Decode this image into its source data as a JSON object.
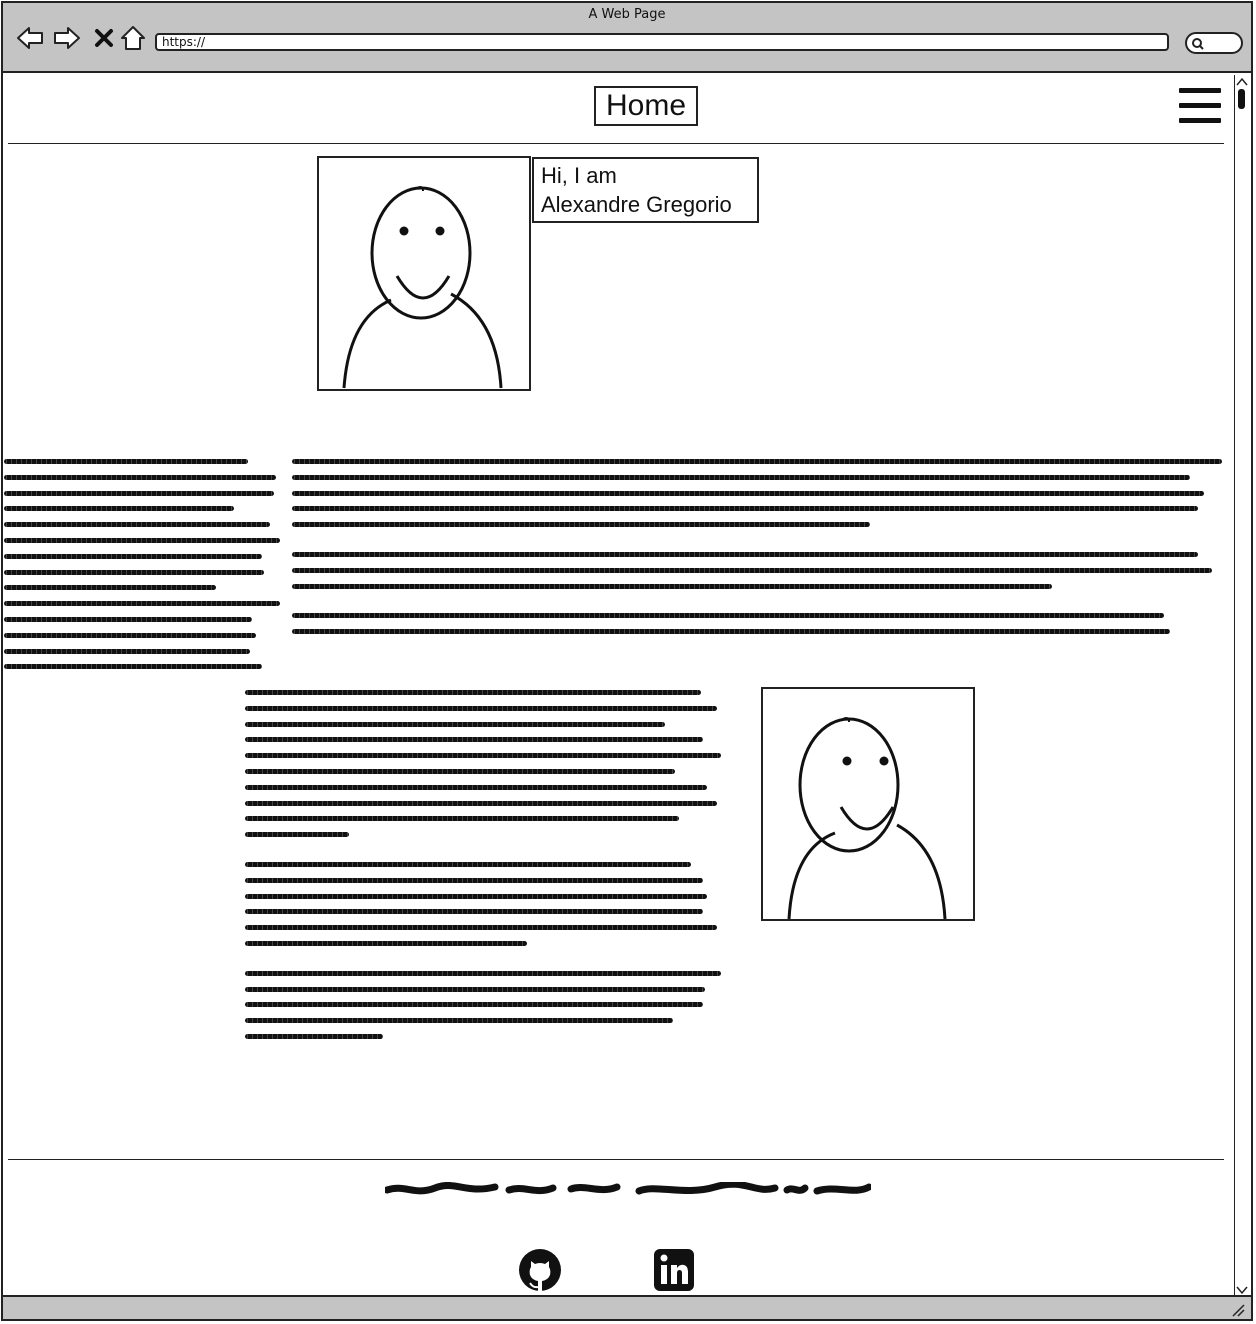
{
  "browser": {
    "window_title": "A Web Page",
    "url": "https://",
    "icons": [
      "back-arrow-icon",
      "forward-arrow-icon",
      "close-icon",
      "home-icon",
      "search-icon"
    ]
  },
  "header": {
    "title": "Home",
    "menu_icon": "hamburger-menu-icon"
  },
  "hero": {
    "greeting_line1": "Hi, I am",
    "greeting_line2": "Alexandre Gregorio",
    "avatar": "user-avatar-placeholder"
  },
  "footer": {
    "social_icons": [
      "github-icon",
      "linkedin-icon"
    ]
  }
}
